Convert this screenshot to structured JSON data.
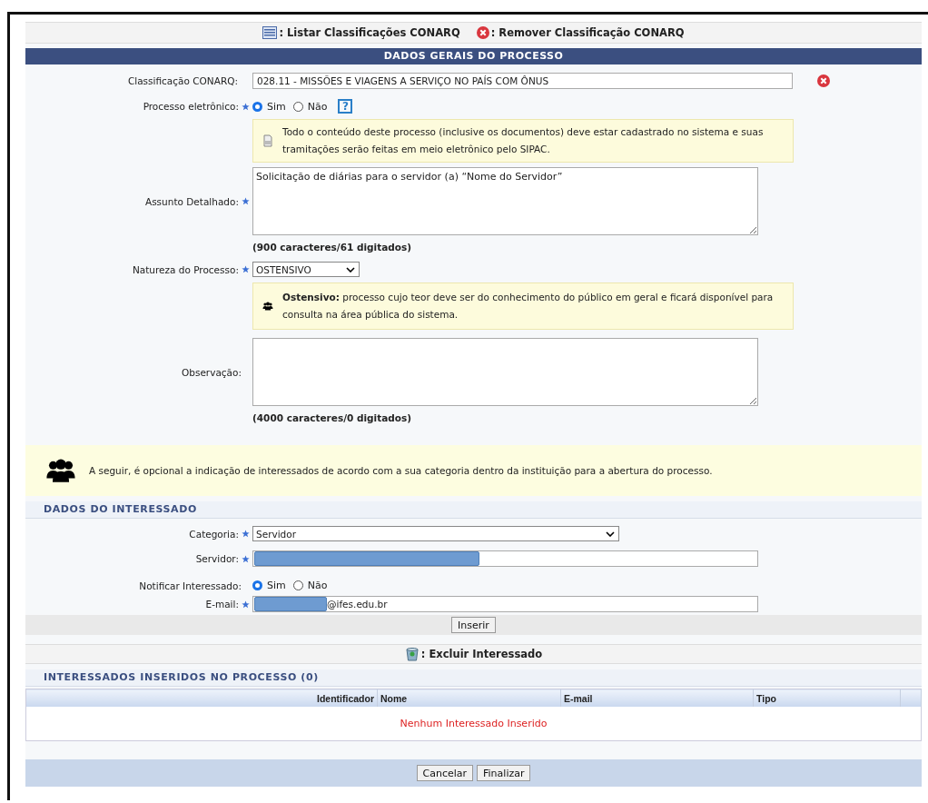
{
  "toolbar": [
    {
      "kind": "list",
      "label": ": Listar Classificações CONARQ"
    },
    {
      "kind": "remove",
      "label": ": Remover Classificação CONARQ"
    }
  ],
  "section_title": "DADOS GERAIS DO PROCESSO",
  "classificacao": {
    "label": "Classificação CONARQ:",
    "value": "028.11 - MISSÕES E VIAGENS A SERVIÇO NO PAÍS COM ÔNUS"
  },
  "processo_eletronico": {
    "label": "Processo eletrônico:",
    "required": true,
    "help": "?",
    "options": [
      {
        "label": "Sim",
        "selected": true
      },
      {
        "label": "Não",
        "selected": false
      }
    ]
  },
  "eletronico_info": "Todo o conteúdo deste processo (inclusive os documentos) deve estar cadastrado no sistema e suas tramitações serão feitas em meio eletrônico pelo SIPAC.",
  "assunto": {
    "label": "Assunto Detalhado:",
    "required": true,
    "value": "Solicitação de diárias para o servidor (a) “Nome do Servidor”",
    "counter": "(900 caracteres/61 digitados)"
  },
  "natureza": {
    "label": "Natureza do Processo:",
    "required": true,
    "value": "OSTENSIVO"
  },
  "natureza_info": "**Ostensivo:** processo cujo teor deve ser do conhecimento do público em geral e ficará disponível para consulta na área pública do sistema.",
  "observacao": {
    "label": "Observação:",
    "counter": "(4000 caracteres/0 digitados)"
  },
  "optional_notice": "A seguir, é opcional a indicação de interessados de acordo com a sua categoria dentro da instituição para a abertura do processo.",
  "interessado_title": "DADOS DO INTERESSADO",
  "categoria": {
    "label": "Categoria:",
    "required": true,
    "value": "Servidor"
  },
  "servidor": {
    "label": "Servidor:",
    "required": true
  },
  "notificar": {
    "label": "Notificar Interessado:",
    "options": [
      {
        "label": "Sim",
        "selected": true
      },
      {
        "label": "Não",
        "selected": false
      }
    ]
  },
  "email": {
    "label": "E-mail:",
    "required": true,
    "value": "@ifes.edu.br"
  },
  "insert_button": "Inserir",
  "exclude_tool": ": Excluir Interessado",
  "inseridos_title": "INTERESSADOS INSERIDOS NO PROCESSO (0)",
  "table": {
    "columns": [
      "Identificador",
      "Nome",
      "E-mail",
      "Tipo"
    ],
    "empty_message": "Nenhum Interessado Inserido"
  },
  "buttons": [
    "Cancelar",
    "Finalizar"
  ]
}
